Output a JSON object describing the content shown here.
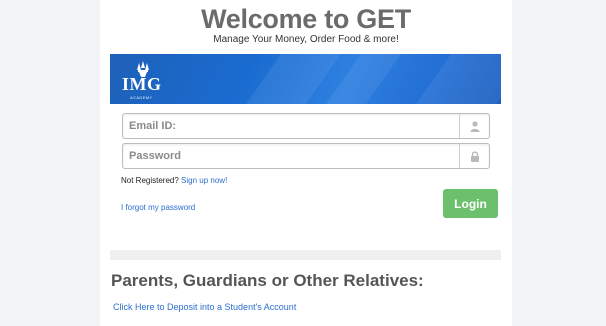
{
  "header": {
    "title": "Welcome to GET",
    "subtitle": "Manage Your Money, Order Food & more!"
  },
  "banner": {
    "logo_text": "IMG",
    "logo_subtext": "ACADEMY",
    "logo_icon": "torch-icon",
    "color": "#1e61b8"
  },
  "login_form": {
    "email_placeholder": "Email ID:",
    "email_value": "",
    "email_icon": "user-icon",
    "password_placeholder": "Password",
    "password_value": "",
    "password_icon": "lock-icon",
    "register_text": "Not Registered?",
    "register_link": "Sign up now!",
    "forgot_link": "I forgot my password",
    "login_label": "Login",
    "login_color": "#6cc06d"
  },
  "parents": {
    "heading": "Parents, Guardians or Other Relatives:",
    "deposit_link": "Click Here to Deposit into a Student's Account"
  }
}
